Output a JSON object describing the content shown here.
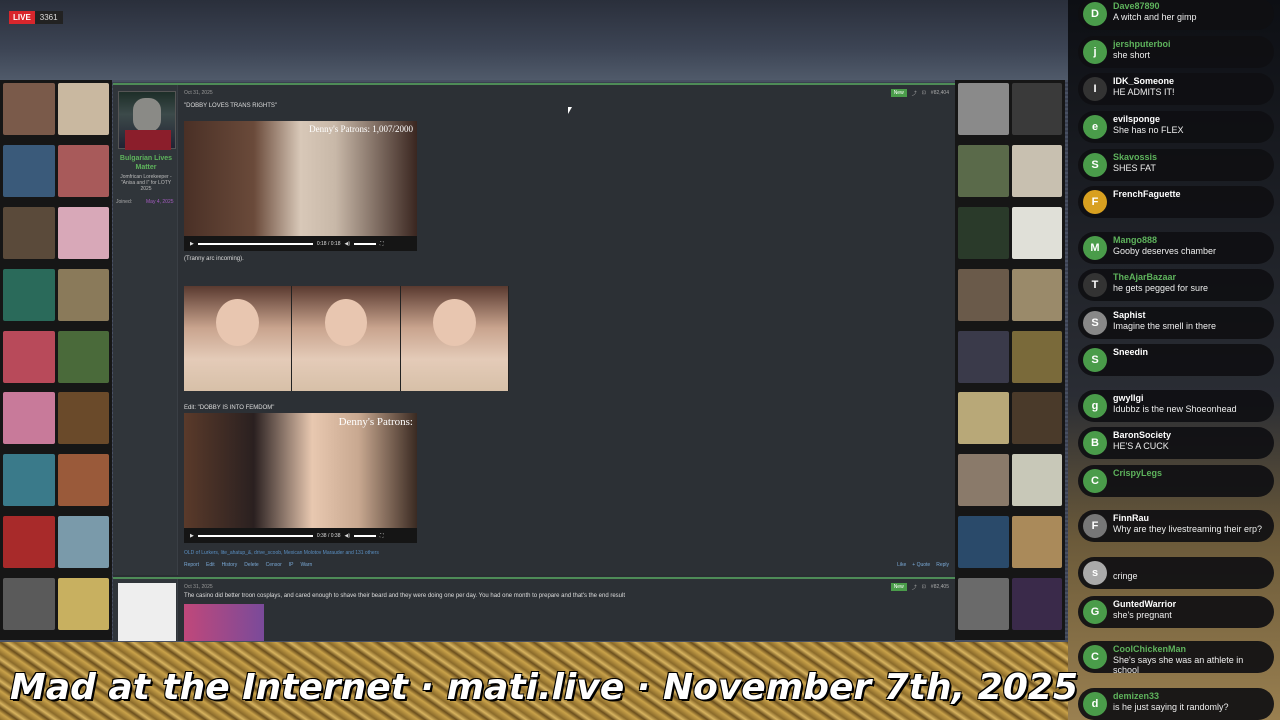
{
  "stream": {
    "live_label": "LIVE",
    "viewer_count": "3361"
  },
  "banner": {
    "text": "Mad at the Internet · mati.live · November 7th, 2025"
  },
  "forum": {
    "post1": {
      "user": {
        "name": "Bulgarian Lives Matter",
        "title": "Jomfrican Lorekeeper - \"Anisa and I\" for LOTY 2025",
        "joined_label": "Joined:",
        "joined_date": "May 4, 2025"
      },
      "date": "Oct 31, 2025",
      "new_badge": "New",
      "post_number": "#82,404",
      "quote": "\"DOBBY LOVES TRANS RIGHTS\"",
      "video1": {
        "overlay": "Denny's Patrons: 1,007/2000",
        "time": "0:18 / 0:18"
      },
      "caption1": "(Tranny arc incoming).",
      "edit_text": "Edit: \"DOBBY IS INTO FEMDOM\"",
      "video2": {
        "overlay": "Denny's Patrons:",
        "time": "0:38 / 0:38"
      },
      "reactions": "OLD of Lurkers, lite_ahatup_&, drive_scoob, Mexican Molotov Marauder and 131 others",
      "footer": [
        "Report",
        "Edit",
        "History",
        "Delete",
        "Censor",
        "IP",
        "Warn"
      ],
      "footer_right": [
        "Like",
        "+ Quote",
        "Reply"
      ]
    },
    "post2": {
      "date": "Oct 31, 2025",
      "new_badge": "New",
      "post_number": "#82,405",
      "text": "The casino did better troon cosplays, and cared enough to shave their beard and they were doing one per day. You had one month to prepare and that's the end result"
    }
  },
  "chat": [
    {
      "initial": "D",
      "name": "Dave87890",
      "text": "A witch and her gimp",
      "color": "#5eb35c",
      "avatar_bg": "#4a9c4a"
    },
    {
      "initial": "j",
      "name": "jershputerboi",
      "text": "she short",
      "color": "#5eb35c",
      "avatar_bg": "#4a9c4a"
    },
    {
      "initial": "I",
      "name": "IDK_Someone",
      "text": "HE ADMITS IT!",
      "color": "#ffffff",
      "avatar_bg": "#333333"
    },
    {
      "initial": "e",
      "name": "evilsponge",
      "text": "She has no FLEX",
      "color": "#ffffff",
      "avatar_bg": "#4a9c4a"
    },
    {
      "initial": "S",
      "name": "Skavossis",
      "text": "SHES FAT",
      "color": "#5eb35c",
      "avatar_bg": "#4a9c4a"
    },
    {
      "initial": "F",
      "name": "FrenchFaguette",
      "text": "",
      "color": "#ffffff",
      "avatar_bg": "#d8a020"
    },
    {
      "initial": "M",
      "name": "Mango888",
      "text": "Gooby deserves chamber",
      "color": "#5eb35c",
      "avatar_bg": "#4a9c4a"
    },
    {
      "initial": "T",
      "name": "TheAjarBazaar",
      "text": "he gets pegged for sure",
      "color": "#5eb35c",
      "avatar_bg": "#333333"
    },
    {
      "initial": "S",
      "name": "Saphist",
      "text": "Imagine the smell in there",
      "color": "#ffffff",
      "avatar_bg": "#888888"
    },
    {
      "initial": "S",
      "name": "Sneedin",
      "text": "",
      "color": "#ffffff",
      "avatar_bg": "#4a9c4a"
    },
    {
      "initial": "g",
      "name": "gwyllgi",
      "text": "Idubbz is the new Shoeonhead",
      "color": "#ffffff",
      "avatar_bg": "#4a9c4a"
    },
    {
      "initial": "B",
      "name": "BaronSociety",
      "text": "HE'S A CUCK",
      "color": "#ffffff",
      "avatar_bg": "#4a9c4a"
    },
    {
      "initial": "C",
      "name": "CrispyLegs",
      "text": "",
      "color": "#5eb35c",
      "avatar_bg": "#4a9c4a"
    },
    {
      "initial": "F",
      "name": "FinnRau",
      "text": "Why are they livestreaming their erp?",
      "color": "#ffffff",
      "avatar_bg": "#777777"
    },
    {
      "initial": "s",
      "name": "",
      "text": "cringe",
      "color": "#a45cc0",
      "avatar_bg": "#aaaaaa"
    },
    {
      "initial": "G",
      "name": "GuntedWarrior",
      "text": "she's pregnant",
      "color": "#ffffff",
      "avatar_bg": "#4a9c4a"
    },
    {
      "initial": "C",
      "name": "CoolChickenMan",
      "text": "She's says she was an athlete in school",
      "color": "#5eb35c",
      "avatar_bg": "#4a9c4a"
    },
    {
      "initial": "d",
      "name": "demizen33",
      "text": "is he just saying it randomly?",
      "color": "#5eb35c",
      "avatar_bg": "#4a9c4a"
    }
  ]
}
